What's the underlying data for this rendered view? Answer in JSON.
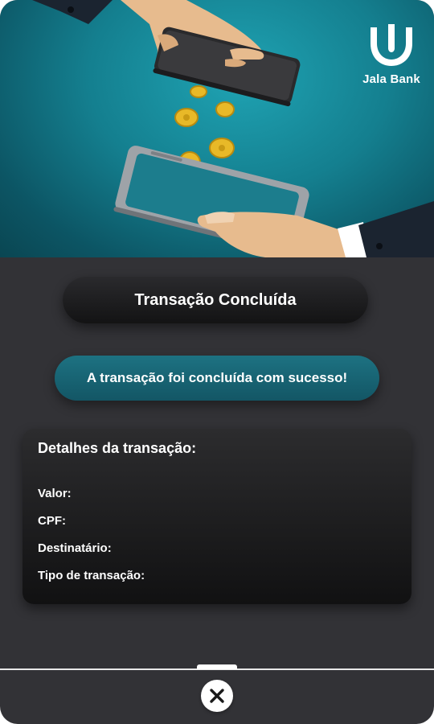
{
  "brand": {
    "name": "Jala Bank",
    "logo_icon": "jala-bank-logo-icon"
  },
  "hero": {
    "illustration": "phone-to-phone-coin-transfer"
  },
  "title": {
    "label": "Transação Concluída"
  },
  "status": {
    "message": "A transação foi concluída com sucesso!"
  },
  "details": {
    "heading": "Detalhes da transação:",
    "fields": [
      {
        "label": "Valor:"
      },
      {
        "label": "CPF:"
      },
      {
        "label": "Destinatário:"
      },
      {
        "label": "Tipo de transação:"
      }
    ]
  },
  "footer": {
    "close_icon": "close-icon"
  },
  "colors": {
    "background": "#323236",
    "teal_accent": "#1d7282",
    "hero_teal": "#147f8f",
    "card_dark": "#131314",
    "text": "#ffffff"
  }
}
